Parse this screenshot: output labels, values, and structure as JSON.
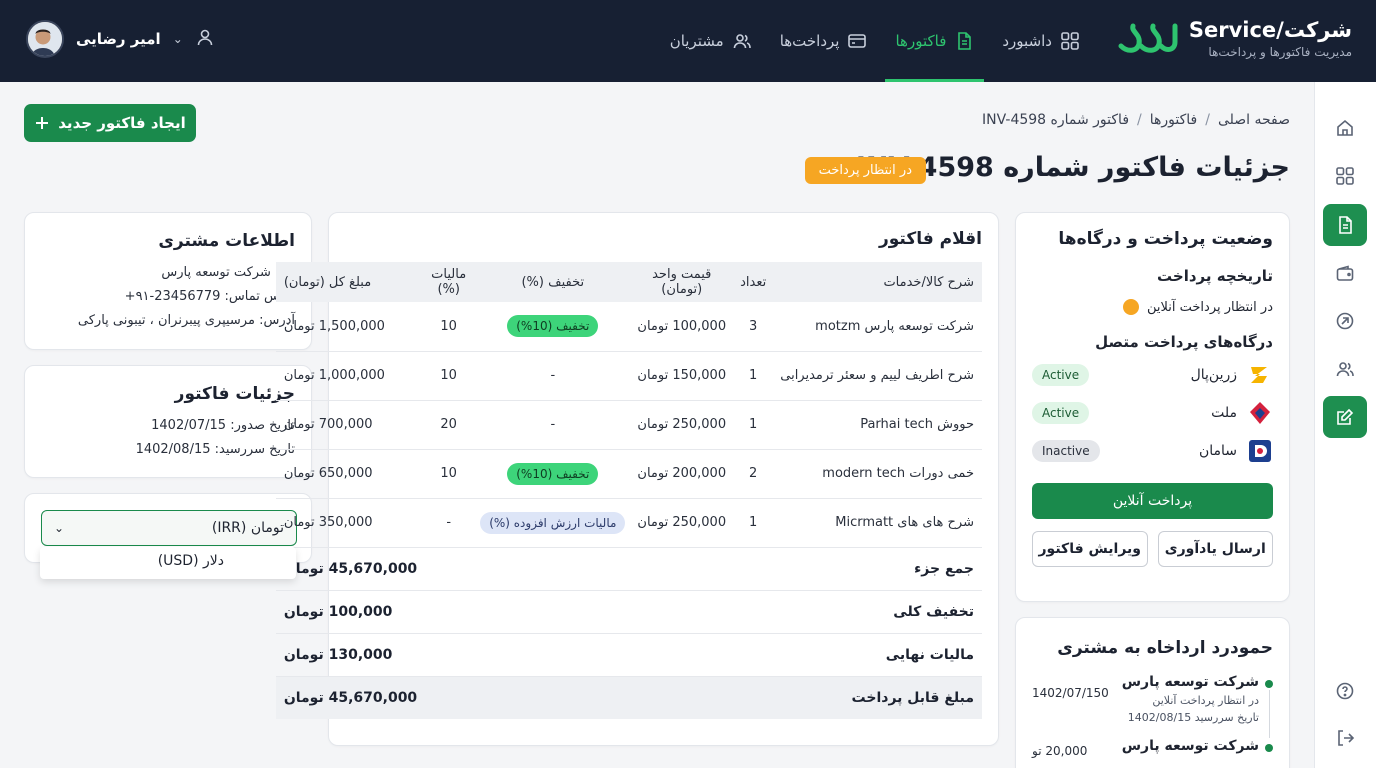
{
  "header": {
    "brand_name": "شرکت/Service",
    "brand_sub": "مدیریت فاکتورها و پرداخت‌ها",
    "nav": [
      {
        "label": "داشبورد",
        "icon": "grid-icon"
      },
      {
        "label": "فاکتورها",
        "icon": "document-icon",
        "active": true
      },
      {
        "label": "پرداخت‌ها",
        "icon": "card-icon"
      },
      {
        "label": "مشتریان",
        "icon": "users-icon"
      }
    ],
    "user_name": "امیر رضایی"
  },
  "breadcrumb": [
    "صفحه اصلی",
    "فاکتورها",
    "فاکتور شماره INV-4598"
  ],
  "breadcrumb_sep": "/",
  "page_title": "جزئیات فاکتور شماره INV-4598",
  "status_badge": "در انتظار پرداخت",
  "create_button": "ایجاد فاکتور جدید",
  "customer": {
    "title": "اطلاعات مشتری",
    "name": "نام: شرکت توسعه پارس",
    "phone": "تماس تماس: 23456779-۹۱+",
    "address": "آدرس: مرسیپری پیبرنران ، تیبونی پارکی"
  },
  "invoice_details": {
    "title": "جزئیات فاکتور",
    "issue_date": "تاریخ صدور: 1402/07/15",
    "due_date": "تاریخ سررسید: 1402/08/15"
  },
  "currency": {
    "selected": "تومان (IRR)",
    "options": [
      "دلار (USD)"
    ]
  },
  "items": {
    "title": "اقلام فاکتور",
    "columns": [
      "شرح کالا/خدمات",
      "تعداد",
      "قیمت واحد (تومان)",
      "تخفیف (%)",
      "مالیات (%)",
      "مبلغ کل (تومان)"
    ],
    "rows": [
      {
        "desc": "شرکت توسعه پارس motzm",
        "qty": "3",
        "unit": "100,000 تومان",
        "discount": "تخفیف (10%)",
        "discount_type": "badge",
        "tax": "10",
        "total": "1,500,000 تومان"
      },
      {
        "desc": "شرح اطریف لییم و سعئر ترمدیرابی",
        "qty": "1",
        "unit": "150,000 تومان",
        "discount": "-",
        "discount_type": "text",
        "tax": "10",
        "total": "1,000,000 تومان"
      },
      {
        "desc": "حووش Parhai tech",
        "qty": "1",
        "unit": "250,000 تومان",
        "discount": "-",
        "discount_type": "text",
        "tax": "20",
        "total": "700,000 تومان"
      },
      {
        "desc": "خمی دورات modern tech",
        "qty": "2",
        "unit": "200,000 تومان",
        "discount": "تخفیف (10%)",
        "discount_type": "badge",
        "tax": "10",
        "total": "650,000 تومان"
      },
      {
        "desc": "شرح های های Micrmatt",
        "qty": "1",
        "unit": "250,000 تومان",
        "discount": "مالیات ارزش افزوده (%)",
        "discount_type": "tax",
        "tax": "-",
        "total": "350,000 تومان"
      }
    ],
    "summary": [
      {
        "label": "جمع جزء",
        "value": "45,670,000 تومان"
      },
      {
        "label": "تخفیف کلی",
        "value": "100,000 تومان"
      },
      {
        "label": "مالیات نهایی",
        "value": "130,000 تومان"
      },
      {
        "label": "مبلغ قابل پرداخت",
        "value": "45,670,000 تومان",
        "final": true
      }
    ]
  },
  "payment": {
    "title": "وضعیت پرداخت و درگاه‌ها",
    "history_title": "تاریخچه پرداخت",
    "history_item": "در انتظار پرداخت آنلاین",
    "gateways_title": "درگاه‌های پرداخت متصل",
    "gateways": [
      {
        "name": "زرین‌پال",
        "status": "Active",
        "color": "#f6b400"
      },
      {
        "name": "ملت",
        "status": "Active",
        "color": "#d4213d"
      },
      {
        "name": "سامان",
        "status": "Inactive",
        "color": "#1d3f8f"
      }
    ],
    "pay_button": "پرداخت آنلاین",
    "reminder_button": "ارسال یادآوری",
    "edit_button": "ویرایش فاکتور"
  },
  "activity": {
    "title": "حمودرد ارداخاه به مشتری",
    "items": [
      {
        "title": "شرکت توسعه پارس",
        "sub1": "در انتظار پرداخت آنلاین",
        "sub2": "تاریخ سررسید 1402/08/15",
        "date": "1402/07/150"
      },
      {
        "title": "شرکت توسعه پارس",
        "date": "20,000 تو"
      }
    ]
  },
  "colors": {
    "topbar": "#172033",
    "accent": "#1a8a4c",
    "pending": "#f6a623"
  }
}
